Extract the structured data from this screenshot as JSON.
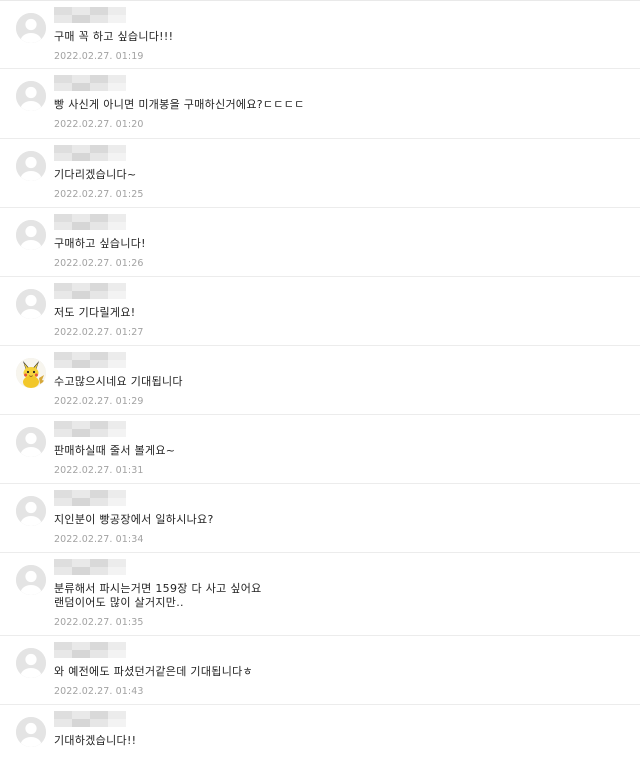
{
  "comments": [
    {
      "text": "구매 꼭 하고 싶습니다!!!",
      "time": "2022.02.27.  01:19",
      "avatar": "default-avatar"
    },
    {
      "text": "빵 사신게 아니면 미개봉을 구매하신거에요?ㄷㄷㄷㄷ",
      "time": "2022.02.27.  01:20",
      "avatar": "default-avatar"
    },
    {
      "text": "기다리겠습니다~",
      "time": "2022.02.27.  01:25",
      "avatar": "default-avatar"
    },
    {
      "text": "구매하고 싶습니다!",
      "time": "2022.02.27.  01:26",
      "avatar": "default-avatar"
    },
    {
      "text": "저도 기다릴게요!",
      "time": "2022.02.27.  01:27",
      "avatar": "default-avatar"
    },
    {
      "text": "수고많으시네요 기대됩니다",
      "time": "2022.02.27.  01:29",
      "avatar": "pikachu-avatar"
    },
    {
      "text": "판매하실때 줄서 볼게요~",
      "time": "2022.02.27.  01:31",
      "avatar": "default-avatar"
    },
    {
      "text": "지인분이 빵공장에서 일하시나요?",
      "time": "2022.02.27.  01:34",
      "avatar": "default-avatar"
    },
    {
      "text": "분류해서 파시는거면 159장 다 사고 싶어요\n랜덤이어도 많이 살거지만..",
      "time": "2022.02.27.  01:35",
      "avatar": "default-avatar"
    },
    {
      "text": "와 예전에도 파셨던거같은데 기대됩니다ㅎ",
      "time": "2022.02.27.  01:43",
      "avatar": "default-avatar"
    },
    {
      "text": "기대하겠습니다!!",
      "time": "",
      "avatar": "default-avatar"
    }
  ]
}
